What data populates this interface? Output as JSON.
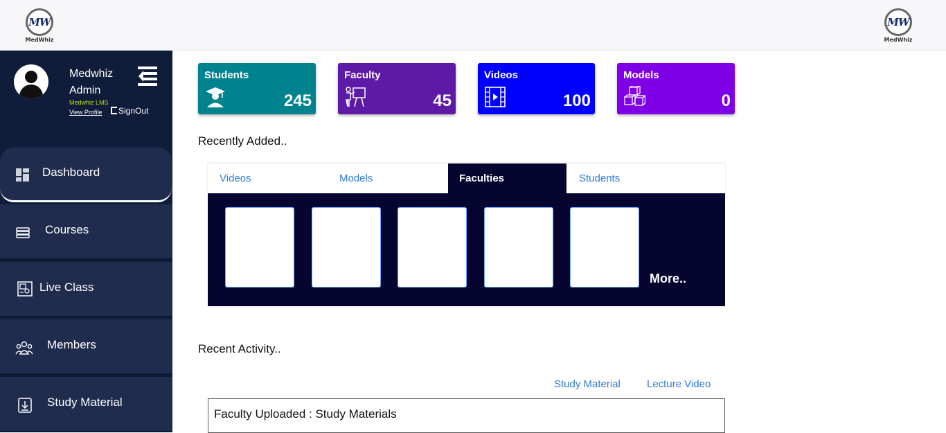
{
  "header": {
    "logo_text": "MedWhiz",
    "logo_mark": "MW"
  },
  "profile": {
    "name": "Medwhiz Admin",
    "subtitle": "Medwhiz LMS",
    "view_profile": "View Profile",
    "sign_out": "SignOut"
  },
  "nav": {
    "items": [
      {
        "label": "Dashboard",
        "icon": "dashboard-icon",
        "active": true
      },
      {
        "label": "Courses",
        "icon": "books-icon"
      },
      {
        "label": "Live Class",
        "icon": "live-class-icon"
      },
      {
        "label": "Members",
        "icon": "members-icon"
      },
      {
        "label": "Study Material",
        "icon": "study-material-icon"
      }
    ]
  },
  "cards": [
    {
      "title": "Students",
      "value": "245",
      "color": "#00838f",
      "icon": "graduate-icon"
    },
    {
      "title": "Faculty",
      "value": "45",
      "color": "#5c1aa6",
      "icon": "teacher-icon"
    },
    {
      "title": "Videos",
      "value": "100",
      "color": "#0000ff",
      "icon": "film-icon"
    },
    {
      "title": "Models",
      "value": "0",
      "color": "#7f00e6",
      "icon": "cubes-icon"
    }
  ],
  "recent": {
    "title": "Recently Added..",
    "tabs": [
      "Videos",
      "Models",
      "Faculties",
      "Students"
    ],
    "active_tab": "Faculties",
    "more": "More.."
  },
  "activity": {
    "title": "Recent Activity..",
    "links": [
      "Study Material",
      "Lecture Video"
    ],
    "entry": "Faculty Uploaded : Study Materials"
  },
  "colors": {
    "sidebar_bg": "#101d3a",
    "nav_item_bg": "#1f2c4d",
    "tab_panel_bg": "#050530",
    "link": "#2c7bd9",
    "lms_label": "#b7d91c"
  }
}
